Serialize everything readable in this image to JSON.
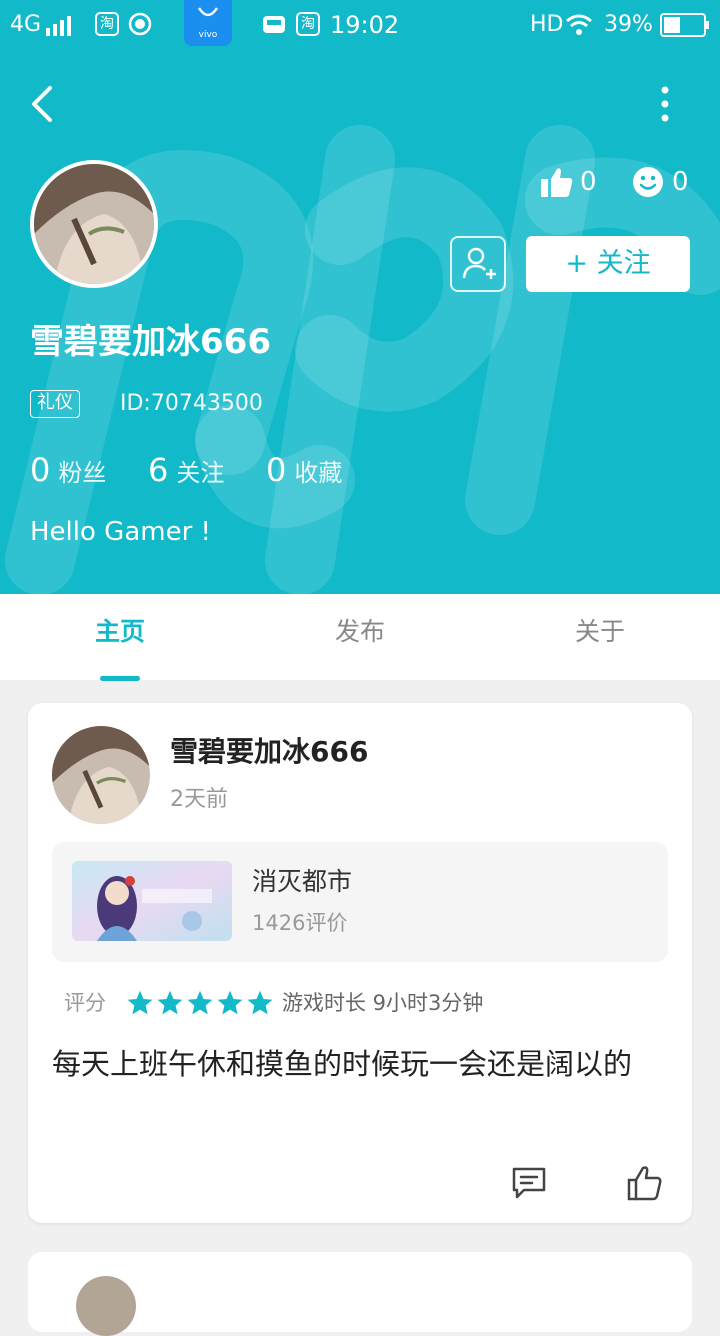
{
  "status_bar": {
    "network": "4G",
    "taobao1": "淘",
    "taobao2": "淘",
    "vivo_label": "vivo",
    "time": "19:02",
    "hd": "HD",
    "battery": "39%"
  },
  "profile": {
    "username": "雪碧要加冰666",
    "badge": "礼仪",
    "user_id": "ID:70743500",
    "likes": "0",
    "smiles": "0",
    "follow_label": "+ 关注",
    "stats": [
      {
        "num": "0",
        "label": "粉丝"
      },
      {
        "num": "6",
        "label": "关注"
      },
      {
        "num": "0",
        "label": "收藏"
      }
    ],
    "bio": "Hello Gamer !"
  },
  "tabs": [
    "主页",
    "发布",
    "关于"
  ],
  "active_tab": "主页",
  "post": {
    "author": "雪碧要加冰666",
    "time": "2天前",
    "game_name": "消灭都市",
    "game_reviews": "1426评价",
    "rating_label": "评分",
    "stars": 5,
    "playtime": "游戏时长 9小时3分钟",
    "body": "每天上班午休和摸鱼的时候玩一会还是阔以的"
  },
  "colors": {
    "accent": "#12b9c9",
    "background": "#f0f0f0"
  },
  "icons": [
    "back-arrow-icon",
    "more-vertical-icon",
    "thumbs-up-icon",
    "smile-icon",
    "add-friend-icon",
    "comment-icon",
    "like-icon",
    "star-icon"
  ]
}
